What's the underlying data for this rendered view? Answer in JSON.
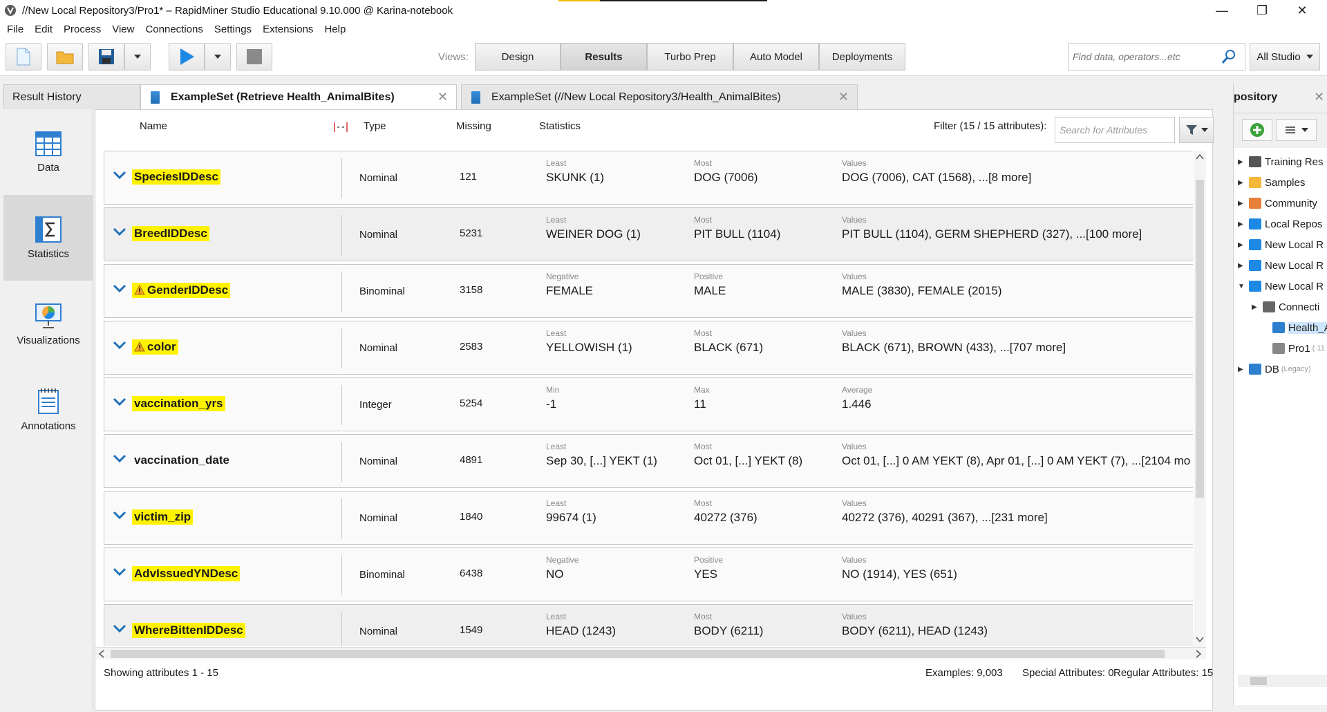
{
  "window": {
    "title": "//New Local Repository3/Pro1* – RapidMiner Studio Educational 9.10.000 @ Karina-notebook",
    "minimize": "—",
    "maximize": "❐",
    "close": "✕"
  },
  "menu": {
    "file": "File",
    "edit": "Edit",
    "process": "Process",
    "view": "View",
    "connections": "Connections",
    "settings": "Settings",
    "extensions": "Extensions",
    "help": "Help"
  },
  "toolbar": {
    "views_label": "Views:",
    "views": [
      "Design",
      "Results",
      "Turbo Prep",
      "Auto Model",
      "Deployments"
    ],
    "active_view": "Results",
    "search_placeholder": "Find data, operators...etc",
    "scope": "All Studio"
  },
  "tabs": [
    {
      "label": "Result History"
    },
    {
      "label": "ExampleSet (Retrieve Health_AnimalBites)",
      "close": "✕"
    },
    {
      "label": "ExampleSet (//New Local Repository3/Health_AnimalBites)",
      "close": "✕"
    }
  ],
  "sidebar": [
    {
      "label": "Data"
    },
    {
      "label": "Statistics"
    },
    {
      "label": "Visualizations"
    },
    {
      "label": "Annotations"
    }
  ],
  "table_header": {
    "name": "Name",
    "type": "Type",
    "missing": "Missing",
    "statistics": "Statistics",
    "filter": "Filter (15 / 15 attributes):",
    "filter_placeholder": "Search for Attributes"
  },
  "rows": [
    {
      "name": "SpeciesIDDesc",
      "type": "Nominal",
      "missing": "121",
      "l1": "Least",
      "v1": "SKUNK (1)",
      "l2": "Most",
      "v2": "DOG (7006)",
      "l3": "Values",
      "v3": "DOG (7006), CAT (1568), ...[8 more]"
    },
    {
      "name": "BreedIDDesc",
      "type": "Nominal",
      "missing": "5231",
      "l1": "Least",
      "v1": "WEINER DOG (1)",
      "l2": "Most",
      "v2": "PIT BULL (1104)",
      "l3": "Values",
      "v3": "PIT BULL (1104), GERM SHEPHERD (327), ...[100 more]"
    },
    {
      "name": "GenderIDDesc",
      "type": "Binominal",
      "missing": "3158",
      "l1": "Negative",
      "v1": "FEMALE",
      "l2": "Positive",
      "v2": "MALE",
      "l3": "Values",
      "v3": "MALE (3830), FEMALE (2015)"
    },
    {
      "name": "color",
      "type": "Nominal",
      "missing": "2583",
      "l1": "Least",
      "v1": "YELLOWISH (1)",
      "l2": "Most",
      "v2": "BLACK (671)",
      "l3": "Values",
      "v3": "BLACK (671), BROWN (433), ...[707 more]"
    },
    {
      "name": "vaccination_yrs",
      "type": "Integer",
      "missing": "5254",
      "l1": "Min",
      "v1": "-1",
      "l2": "Max",
      "v2": "11",
      "l3": "Average",
      "v3": "1.446"
    },
    {
      "name": "vaccination_date",
      "type": "Nominal",
      "missing": "4891",
      "l1": "Least",
      "v1": "Sep 30,  [...]  YEKT (1)",
      "l2": "Most",
      "v2": "Oct 01,  [...]  YEKT (8)",
      "l3": "Values",
      "v3": "Oct 01,  [...] 0 AM YEKT (8), Apr 01,  [...] 0 AM YEKT (7), ...[2104 mo"
    },
    {
      "name": "victim_zip",
      "type": "Nominal",
      "missing": "1840",
      "l1": "Least",
      "v1": "99674 (1)",
      "l2": "Most",
      "v2": "40272 (376)",
      "l3": "Values",
      "v3": "40272 (376), 40291 (367), ...[231 more]"
    },
    {
      "name": "AdvIssuedYNDesc",
      "type": "Binominal",
      "missing": "6438",
      "l1": "Negative",
      "v1": "NO",
      "l2": "Positive",
      "v2": "YES",
      "l3": "Values",
      "v3": "NO (1914), YES (651)"
    },
    {
      "name": "WhereBittenIDDesc",
      "type": "Nominal",
      "missing": "1549",
      "l1": "Least",
      "v1": "HEAD (1243)",
      "l2": "Most",
      "v2": "BODY (6211)",
      "l3": "Values",
      "v3": "BODY (6211), HEAD (1243)"
    }
  ],
  "status": {
    "showing": "Showing attributes 1 - 15",
    "examples": "Examples: 9,003",
    "special": "Special Attributes: 0",
    "regular": "Regular Attributes: 15"
  },
  "repository": {
    "title": "pository",
    "close": "✕",
    "items": [
      {
        "label": "Training Res"
      },
      {
        "label": "Samples"
      },
      {
        "label": "Community"
      },
      {
        "label": "Local Repos"
      },
      {
        "label": "New Local R"
      },
      {
        "label": "New Local R"
      },
      {
        "label": "New Local R"
      },
      {
        "label": "Connecti"
      },
      {
        "label": "Health_A"
      },
      {
        "label": "Pro1",
        "small": "( 11"
      },
      {
        "label": "DB",
        "small": "(Legacy)"
      }
    ]
  },
  "colors": {
    "highlight": "#fff200",
    "accent_blue": "#1f6fb8",
    "play_blue": "#1e88e5"
  }
}
